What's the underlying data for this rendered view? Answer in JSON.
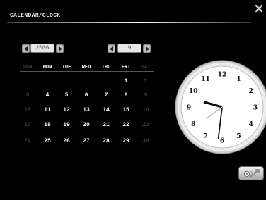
{
  "window": {
    "title": "CALENDAR/CLOCK"
  },
  "calendar": {
    "year": "2006",
    "month": "9",
    "weekdays": [
      "SUN",
      "MON",
      "TUE",
      "WED",
      "THU",
      "FRI",
      "SAT"
    ],
    "weeks": [
      [
        "",
        "",
        "",
        "",
        "",
        "1",
        "2"
      ],
      [
        "3",
        "4",
        "5",
        "6",
        "7",
        "8",
        "9"
      ],
      [
        "10",
        "11",
        "12",
        "13",
        "14",
        "15",
        "16"
      ],
      [
        "17",
        "18",
        "19",
        "20",
        "21",
        "22",
        "23"
      ],
      [
        "24",
        "25",
        "26",
        "27",
        "28",
        "29",
        "30"
      ]
    ],
    "colors": {
      "weekend": "#3d3d3d",
      "weekday": "#ffffff"
    }
  },
  "clock": {
    "numerals": [
      "12",
      "1",
      "2",
      "3",
      "4",
      "5",
      "6",
      "7",
      "8",
      "9",
      "10",
      "11"
    ],
    "time": {
      "hour": 9,
      "minute": 31,
      "second": 9
    },
    "colors": {
      "face": "#ffffff",
      "rim": "#d8d8d8",
      "hands": "#111111",
      "second_hand": "#bbbbbb"
    }
  },
  "icons": {
    "close": "close-icon",
    "settings": "tools-icon",
    "prev": "arrow-left-icon",
    "next": "arrow-right-icon"
  }
}
